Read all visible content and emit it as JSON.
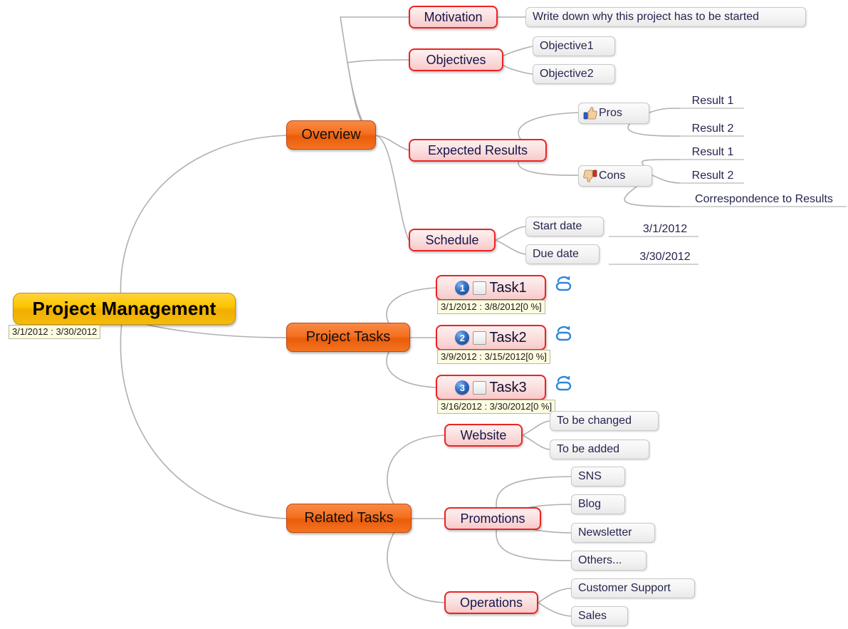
{
  "document": {
    "type": "mindmap",
    "title": "Project Management"
  },
  "root": {
    "label": "Project Management",
    "date_range": "3/1/2012 : 3/30/2012",
    "color": "#f5bb0c"
  },
  "branches": [
    {
      "label": "Overview",
      "color": "#ee5f0c",
      "children": [
        {
          "label": "Motivation",
          "children": [
            {
              "label": "Write down why this project has to be started",
              "style": "box"
            }
          ]
        },
        {
          "label": "Objectives",
          "children": [
            {
              "label": "Objective1",
              "style": "box"
            },
            {
              "label": "Objective2",
              "style": "box"
            }
          ]
        },
        {
          "label": "Expected Results",
          "children": [
            {
              "label": "Pros",
              "style": "box",
              "icon": "thumbs-up-icon",
              "children": [
                {
                  "label": "Result 1",
                  "style": "line"
                },
                {
                  "label": "Result 2",
                  "style": "line"
                }
              ]
            },
            {
              "label": "Cons",
              "style": "box",
              "icon": "thumbs-down-icon",
              "children": [
                {
                  "label": "Result 1",
                  "style": "line"
                },
                {
                  "label": "Result 2",
                  "style": "line"
                },
                {
                  "label": "Correspondence to Results",
                  "style": "line"
                }
              ]
            }
          ]
        },
        {
          "label": "Schedule",
          "children": [
            {
              "label": "Start date",
              "style": "box",
              "value": "3/1/2012"
            },
            {
              "label": "Due date",
              "style": "box",
              "value": "3/30/2012"
            }
          ]
        }
      ]
    },
    {
      "label": "Project Tasks",
      "color": "#ee5f0c",
      "children": [
        {
          "label": "Task1",
          "style": "task",
          "number": "1",
          "checked": false,
          "icon": "task-repeat-icon",
          "date_range": "3/1/2012 : 3/8/2012[0 %]"
        },
        {
          "label": "Task2",
          "style": "task",
          "number": "2",
          "checked": false,
          "icon": "task-repeat-icon",
          "date_range": "3/9/2012 : 3/15/2012[0 %]"
        },
        {
          "label": "Task3",
          "style": "task",
          "number": "3",
          "checked": false,
          "icon": "task-repeat-icon",
          "date_range": "3/16/2012 : 3/30/2012[0 %]"
        }
      ]
    },
    {
      "label": "Related Tasks",
      "color": "#ee5f0c",
      "children": [
        {
          "label": "Website",
          "children": [
            {
              "label": "To be changed",
              "style": "box"
            },
            {
              "label": "To be added",
              "style": "box"
            }
          ]
        },
        {
          "label": "Promotions",
          "children": [
            {
              "label": "SNS",
              "style": "box"
            },
            {
              "label": "Blog",
              "style": "box"
            },
            {
              "label": "Newsletter",
              "style": "box"
            },
            {
              "label": "Others...",
              "style": "box"
            }
          ]
        },
        {
          "label": "Operations",
          "children": [
            {
              "label": "Customer Support",
              "style": "box"
            },
            {
              "label": "Sales",
              "style": "box"
            }
          ]
        }
      ]
    }
  ],
  "leaf_values": {
    "start_date": "3/1/2012",
    "due_date": "3/30/2012"
  }
}
